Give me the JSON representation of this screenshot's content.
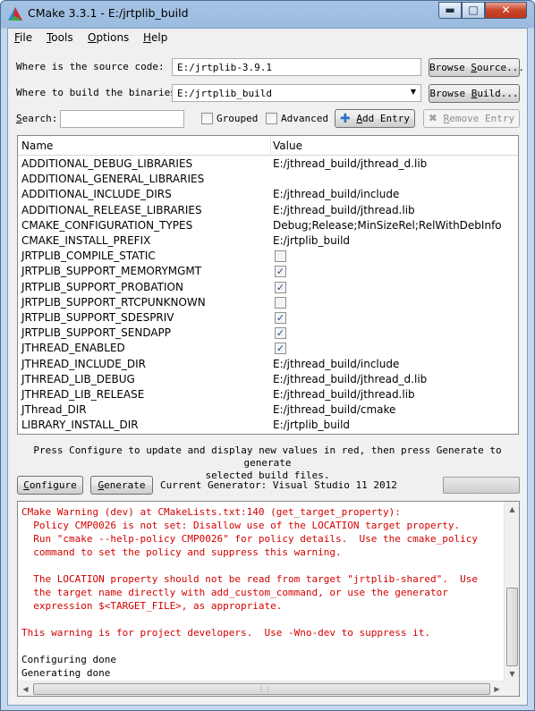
{
  "window": {
    "title": "CMake 3.3.1 - E:/jrtplib_build",
    "min_glyph": "▬",
    "max_glyph": "□",
    "close_glyph": "✕"
  },
  "menu": [
    {
      "key": "F",
      "rest": "ile"
    },
    {
      "key": "T",
      "rest": "ools"
    },
    {
      "key": "O",
      "rest": "ptions"
    },
    {
      "key": "H",
      "rest": "elp"
    }
  ],
  "source": {
    "label": "Where is the source code:",
    "value": "E:/jrtplib-3.9.1",
    "browse_key": "S",
    "browse_pre": "Browse ",
    "browse_post": "ource..."
  },
  "binaries": {
    "label": "Where to build the binaries:",
    "value": "E:/jrtplib_build",
    "browse_key": "B",
    "browse_pre": "Browse ",
    "browse_post": "uild..."
  },
  "search": {
    "key": "S",
    "rest": "earch:",
    "value": ""
  },
  "grouped_label": "Grouped",
  "advanced_label": "Advanced",
  "add_entry": {
    "key": "A",
    "rest": "dd Entry"
  },
  "remove_entry": {
    "key": "R",
    "rest": "emove Entry"
  },
  "table": {
    "headers": {
      "name": "Name",
      "value": "Value"
    },
    "rows": [
      {
        "name": "ADDITIONAL_DEBUG_LIBRARIES",
        "value": "E:/jthread_build/jthread_d.lib"
      },
      {
        "name": "ADDITIONAL_GENERAL_LIBRARIES",
        "value": ""
      },
      {
        "name": "ADDITIONAL_INCLUDE_DIRS",
        "value": "E:/jthread_build/include"
      },
      {
        "name": "ADDITIONAL_RELEASE_LIBRARIES",
        "value": "E:/jthread_build/jthread.lib"
      },
      {
        "name": "CMAKE_CONFIGURATION_TYPES",
        "value": "Debug;Release;MinSizeRel;RelWithDebInfo"
      },
      {
        "name": "CMAKE_INSTALL_PREFIX",
        "value": "E:/jrtplib_build"
      },
      {
        "name": "JRTPLIB_COMPILE_STATIC",
        "checkbox": true,
        "checked": false
      },
      {
        "name": "JRTPLIB_SUPPORT_MEMORYMGMT",
        "checkbox": true,
        "checked": true
      },
      {
        "name": "JRTPLIB_SUPPORT_PROBATION",
        "checkbox": true,
        "checked": true
      },
      {
        "name": "JRTPLIB_SUPPORT_RTCPUNKNOWN",
        "checkbox": true,
        "checked": false
      },
      {
        "name": "JRTPLIB_SUPPORT_SDESPRIV",
        "checkbox": true,
        "checked": true
      },
      {
        "name": "JRTPLIB_SUPPORT_SENDAPP",
        "checkbox": true,
        "checked": true
      },
      {
        "name": "JTHREAD_ENABLED",
        "checkbox": true,
        "checked": true
      },
      {
        "name": "JTHREAD_INCLUDE_DIR",
        "value": "E:/jthread_build/include"
      },
      {
        "name": "JTHREAD_LIB_DEBUG",
        "value": "E:/jthread_build/jthread_d.lib"
      },
      {
        "name": "JTHREAD_LIB_RELEASE",
        "value": "E:/jthread_build/jthread.lib"
      },
      {
        "name": "JThread_DIR",
        "value": "E:/jthread_build/cmake"
      },
      {
        "name": "LIBRARY_INSTALL_DIR",
        "value": "E:/jrtplib_build"
      }
    ]
  },
  "hint_line1": "Press Configure to update and display new values in red, then press Generate to generate",
  "hint_line2": "selected build files.",
  "configure": {
    "key": "C",
    "rest": "onfigure"
  },
  "generate": {
    "key": "G",
    "rest": "enerate"
  },
  "current_generator": "Current Generator: Visual Studio 11 2012",
  "log": {
    "lines": [
      {
        "text": "CMake Warning (dev) at CMakeLists.txt:140 (get_target_property):",
        "color": "red"
      },
      {
        "text": "  Policy CMP0026 is not set: Disallow use of the LOCATION target property.",
        "color": "red"
      },
      {
        "text": "  Run \"cmake --help-policy CMP0026\" for policy details.  Use the cmake_policy",
        "color": "red"
      },
      {
        "text": "  command to set the policy and suppress this warning.",
        "color": "red"
      },
      {
        "text": "",
        "color": "red"
      },
      {
        "text": "  The LOCATION property should not be read from target \"jrtplib-shared\".  Use",
        "color": "red"
      },
      {
        "text": "  the target name directly with add_custom_command, or use the generator",
        "color": "red"
      },
      {
        "text": "  expression $<TARGET_FILE>, as appropriate.",
        "color": "red"
      },
      {
        "text": "",
        "color": "red"
      },
      {
        "text": "This warning is for project developers.  Use -Wno-dev to suppress it.",
        "color": "red"
      },
      {
        "text": "",
        "color": "black"
      },
      {
        "text": "Configuring done",
        "color": "black"
      },
      {
        "text": "Generating done",
        "color": "black"
      }
    ]
  },
  "scroll": {
    "up": "▲",
    "down": "▼",
    "left": "◀",
    "right": "▶",
    "grip": "⋮⋮"
  }
}
